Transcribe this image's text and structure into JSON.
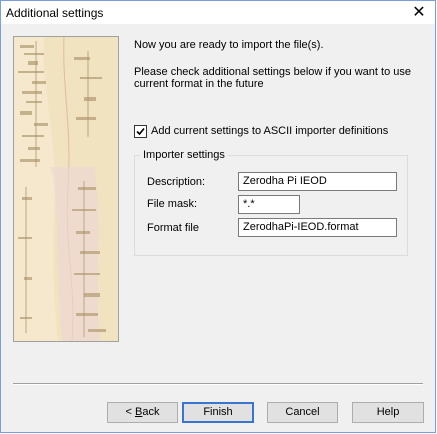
{
  "window": {
    "title": "Additional settings",
    "close_glyph": "✕"
  },
  "intro": {
    "line1": "Now you are ready to import the file(s).",
    "line2a": "Please check additional settings below if you want to use",
    "line2b": "current format in the future"
  },
  "checkbox": {
    "label": "Add current settings to ASCII importer definitions",
    "checked": true,
    "mark": "✓"
  },
  "importer": {
    "group_label": "Importer settings",
    "description": {
      "label": "Description:",
      "value": "Zerodha Pi IEOD"
    },
    "file_mask": {
      "label": "File mask:",
      "value": "*.*"
    },
    "format_file": {
      "label": "Format file",
      "value": "ZerodhaPi-IEOD.format"
    }
  },
  "buttons": {
    "back_mnemonic": "B",
    "back_rest": "ack",
    "back_prefix": "< ",
    "finish": "Finish",
    "cancel": "Cancel",
    "help": "Help"
  },
  "icons": [
    "close-icon",
    "checkmark-icon"
  ]
}
